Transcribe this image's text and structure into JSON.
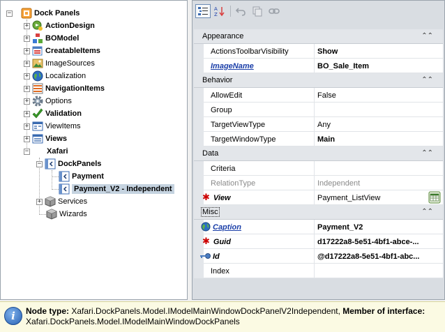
{
  "tree": {
    "root": "Dock Panels",
    "items": [
      {
        "label": "ActionDesign",
        "icon": "action-design-icon"
      },
      {
        "label": "BOModel",
        "icon": "bo-model-icon"
      },
      {
        "label": "CreatableItems",
        "icon": "creatable-items-icon"
      },
      {
        "label": "ImageSources",
        "icon": "image-sources-icon"
      },
      {
        "label": "Localization",
        "icon": "globe-icon"
      },
      {
        "label": "NavigationItems",
        "icon": "navigation-items-icon"
      },
      {
        "label": "Options",
        "icon": "gear-icon"
      },
      {
        "label": "Validation",
        "icon": "checkmark-icon"
      },
      {
        "label": "ViewItems",
        "icon": "view-items-icon"
      },
      {
        "label": "Views",
        "icon": "views-icon"
      },
      {
        "label": "Xafari",
        "icon": ""
      },
      {
        "label": "DockPanels",
        "icon": "dock-panel-icon"
      },
      {
        "label": "Payment",
        "icon": "dock-panel-icon"
      },
      {
        "label": "Payment_V2 - Independent",
        "icon": "dock-panel-icon"
      },
      {
        "label": "Services",
        "icon": "cube-icon"
      },
      {
        "label": "Wizards",
        "icon": "cube-icon"
      }
    ]
  },
  "grid": {
    "appearance": {
      "title": "Appearance",
      "actions_name": "ActionsToolbarVisibility",
      "actions_value": "Show",
      "image_name": "ImageName",
      "image_value": "BO_Sale_Item"
    },
    "behavior": {
      "title": "Behavior",
      "allow_edit_name": "AllowEdit",
      "allow_edit_value": "False",
      "group_name": "Group",
      "group_value": "",
      "target_view_name": "TargetViewType",
      "target_view_value": "Any",
      "target_window_name": "TargetWindowType",
      "target_window_value": "Main"
    },
    "data": {
      "title": "Data",
      "criteria_name": "Criteria",
      "criteria_value": "",
      "relation_name": "RelationType",
      "relation_value": "Independent",
      "view_name": "View",
      "view_value": "Payment_ListView"
    },
    "misc": {
      "title": "Misc",
      "caption_name": "Caption",
      "caption_value": "Payment_V2",
      "guid_name": "Guid",
      "guid_value": "d17222a8-5e51-4bf1-abce-...",
      "id_name": "Id",
      "id_value": "@d17222a8-5e51-4bf1-abc...",
      "index_name": "Index",
      "index_value": ""
    }
  },
  "status": {
    "node_type_label": "Node type:",
    "node_type_value": "Xafari.DockPanels.Model.IModelMainWindowDockPanelV2Independent,",
    "member_label": "Member of interface:",
    "member_value": "Xafari.DockPanels.Model.IModelMainWindowDockPanels"
  },
  "colors": {
    "selection": "#c5d3e0",
    "link": "#1a3ea8",
    "required": "#cc0000",
    "status_bg": "#fbfae3"
  }
}
